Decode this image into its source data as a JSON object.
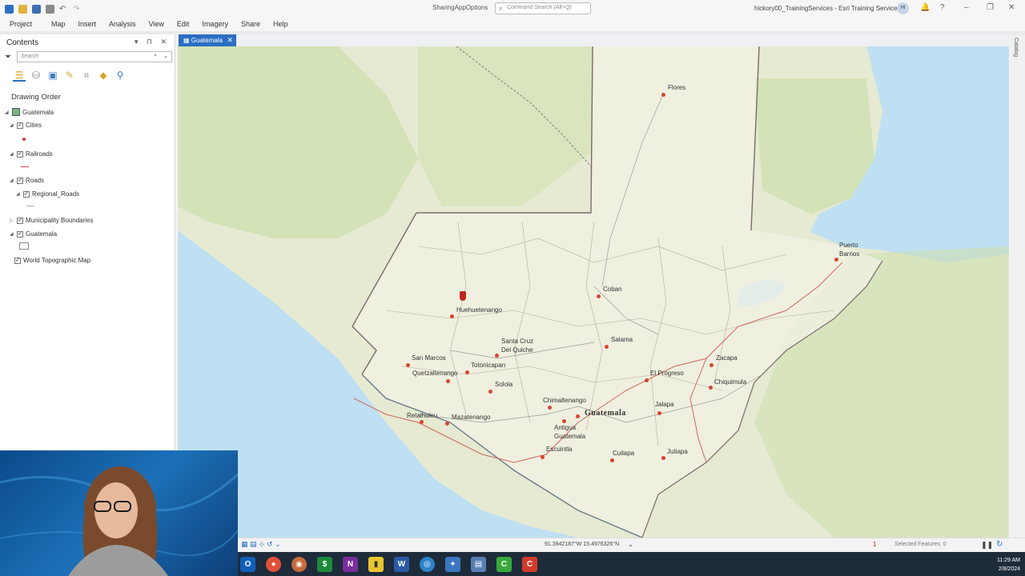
{
  "app": {
    "title": "SharingAppOptions",
    "command_search_placeholder": "Command Search (Alt+Q)",
    "user": "hickory00_TrainingServices - Esri Training Services",
    "avatar_initials": "HI"
  },
  "menu": [
    "Project",
    "Map",
    "Insert",
    "Analysis",
    "View",
    "Edit",
    "Imagery",
    "Share",
    "Help"
  ],
  "contents": {
    "header": "Contents",
    "search_placeholder": "Search",
    "drawing_order": "Drawing Order",
    "layers": {
      "map": "Guatemala",
      "cities": "Cities",
      "railroads": "Railroads",
      "roads": "Roads",
      "regional_roads": "Regional_Roads",
      "municipality": "Municipality Boundaries",
      "guatemala": "Guatemala",
      "basemap": "World Topographic Map"
    }
  },
  "map_tab": "Guatemala",
  "catalog_label": "Catalog",
  "status": {
    "coordinates": "91.3942187°W 15.4976326°N",
    "selected_features": "Selected Features: 0",
    "errors": "1"
  },
  "clock": {
    "time": "11:29 AM",
    "date": "2/8/2024"
  },
  "cities": {
    "flores": "Flores",
    "puerto_barrios": "Puerto\nBarrios",
    "coban": "Coban",
    "huehuetenango": "Huehuetenango",
    "salama": "Salama",
    "santa_cruz": "Santa Cruz\nDel Quiche",
    "zacapa": "Zacapa",
    "san_marcos": "San Marcos",
    "totonicapan": "Totonicapan",
    "el_progreso": "El Progreso",
    "quetzaltenango": "Quetzaltenango",
    "chiquimula": "Chiquimula",
    "solola": "Solola",
    "chimaltenango": "Chimaltenango",
    "jalapa": "Jalapa",
    "retalhuleu": "Retalhuleu",
    "mazatenango": "Mazatenango",
    "guatemala": "Guatemala",
    "antigua": "Antigua\nGuatemala",
    "escuintla": "Escuintla",
    "cuilapa": "Cuilapa",
    "jutiapa": "Jutiapa"
  },
  "colors": {
    "accent": "#2b6fc3",
    "city": "#d6452f",
    "water": "#bfe0f2",
    "land": "#e8ecd6"
  }
}
